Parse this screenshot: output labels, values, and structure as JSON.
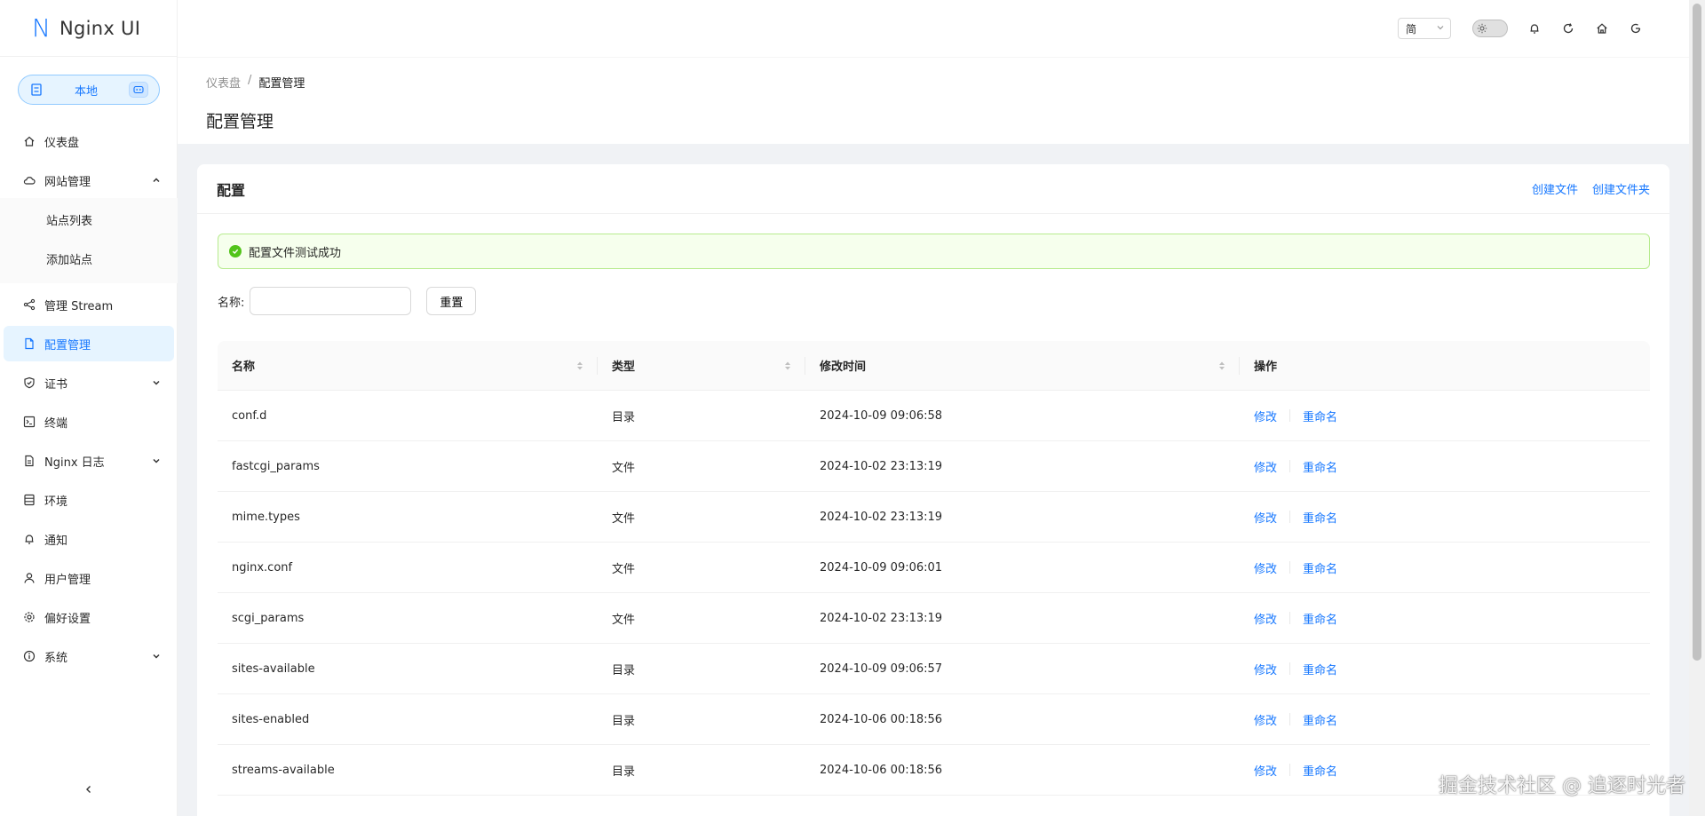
{
  "app": {
    "logo_mark": "N",
    "title": "Nginx UI"
  },
  "env": {
    "label": "本地"
  },
  "sidebar": {
    "items": [
      {
        "label": "仪表盘",
        "icon": "home-icon"
      },
      {
        "label": "网站管理",
        "icon": "cloud-icon",
        "expanded": true,
        "children": [
          {
            "label": "站点列表"
          },
          {
            "label": "添加站点"
          }
        ]
      },
      {
        "label": "管理 Stream",
        "icon": "share-icon"
      },
      {
        "label": "配置管理",
        "icon": "file-icon",
        "active": true
      },
      {
        "label": "证书",
        "icon": "shield-icon",
        "expandable": true
      },
      {
        "label": "终端",
        "icon": "terminal-icon"
      },
      {
        "label": "Nginx 日志",
        "icon": "file-text-icon",
        "expandable": true
      },
      {
        "label": "环境",
        "icon": "database-icon"
      },
      {
        "label": "通知",
        "icon": "bell-icon"
      },
      {
        "label": "用户管理",
        "icon": "user-icon"
      },
      {
        "label": "偏好设置",
        "icon": "settings-icon"
      },
      {
        "label": "系统",
        "icon": "info-icon",
        "expandable": true
      }
    ]
  },
  "header": {
    "language": "简"
  },
  "breadcrumb": {
    "root": "仪表盘",
    "sep": "/",
    "current": "配置管理"
  },
  "page": {
    "title": "配置管理"
  },
  "card": {
    "title": "配置",
    "create_file": "创建文件",
    "create_folder": "创建文件夹"
  },
  "alert": {
    "message": "配置文件测试成功",
    "type": "success"
  },
  "filter": {
    "label": "名称:",
    "value": "",
    "reset": "重置"
  },
  "table": {
    "columns": [
      "名称",
      "类型",
      "修改时间",
      "操作"
    ],
    "rows": [
      {
        "name": "conf.d",
        "type": "目录",
        "time": "2024-10-09 09:06:58"
      },
      {
        "name": "fastcgi_params",
        "type": "文件",
        "time": "2024-10-02 23:13:19"
      },
      {
        "name": "mime.types",
        "type": "文件",
        "time": "2024-10-02 23:13:19"
      },
      {
        "name": "nginx.conf",
        "type": "文件",
        "time": "2024-10-09 09:06:01"
      },
      {
        "name": "scgi_params",
        "type": "文件",
        "time": "2024-10-02 23:13:19"
      },
      {
        "name": "sites-available",
        "type": "目录",
        "time": "2024-10-09 09:06:57"
      },
      {
        "name": "sites-enabled",
        "type": "目录",
        "time": "2024-10-06 00:18:56"
      },
      {
        "name": "streams-available",
        "type": "目录",
        "time": "2024-10-06 00:18:56"
      }
    ],
    "action_edit": "修改",
    "action_rename": "重命名"
  },
  "watermark": "掘金技术社区 @ 追逐时光者",
  "colors": {
    "primary": "#1677ff",
    "success_bg": "#f6ffed",
    "success_border": "#b7eb8f",
    "success_icon": "#52c41a",
    "active_bg": "#e6f4ff"
  }
}
